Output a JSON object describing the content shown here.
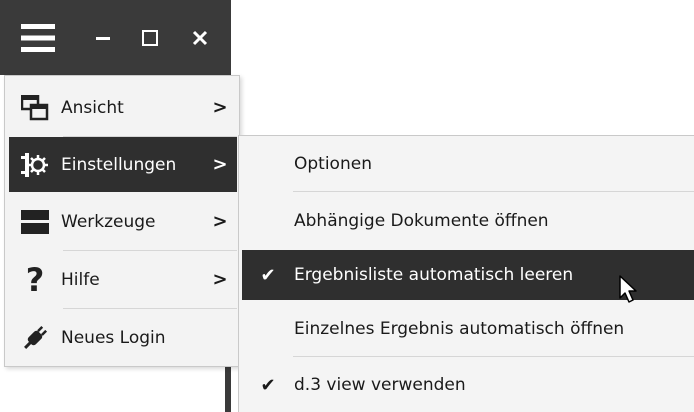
{
  "window": {
    "menu_icon": "hamburger-icon",
    "minimize_icon": "minimize-icon",
    "maximize_icon": "maximize-icon",
    "close_icon": "close-icon"
  },
  "main_menu": {
    "items": [
      {
        "label": "Ansicht",
        "icon": "windows-icon",
        "has_submenu": true
      },
      {
        "label": "Einstellungen",
        "icon": "settings-icon",
        "has_submenu": true
      },
      {
        "label": "Werkzeuge",
        "icon": "toolbox-icon",
        "has_submenu": true
      },
      {
        "label": "Hilfe",
        "icon": "help-icon",
        "has_submenu": true
      },
      {
        "label": "Neues Login",
        "icon": "plug-icon",
        "has_submenu": false
      }
    ],
    "arrow_glyph": ">"
  },
  "sub_menu": {
    "items": [
      {
        "label": "Optionen",
        "checked": false
      },
      {
        "label": "Abhängige Dokumente öffnen",
        "checked": false
      },
      {
        "label": "Ergebnisliste automatisch leeren",
        "checked": true
      },
      {
        "label": "Einzelnes Ergebnis automatisch öffnen",
        "checked": false
      },
      {
        "label": "d.3 view verwenden",
        "checked": true
      }
    ],
    "check_glyph": "✔"
  },
  "colors": {
    "dark": "#3a3a3a",
    "highlight": "#2f2f2f",
    "menu_bg": "#f3f3f3"
  }
}
